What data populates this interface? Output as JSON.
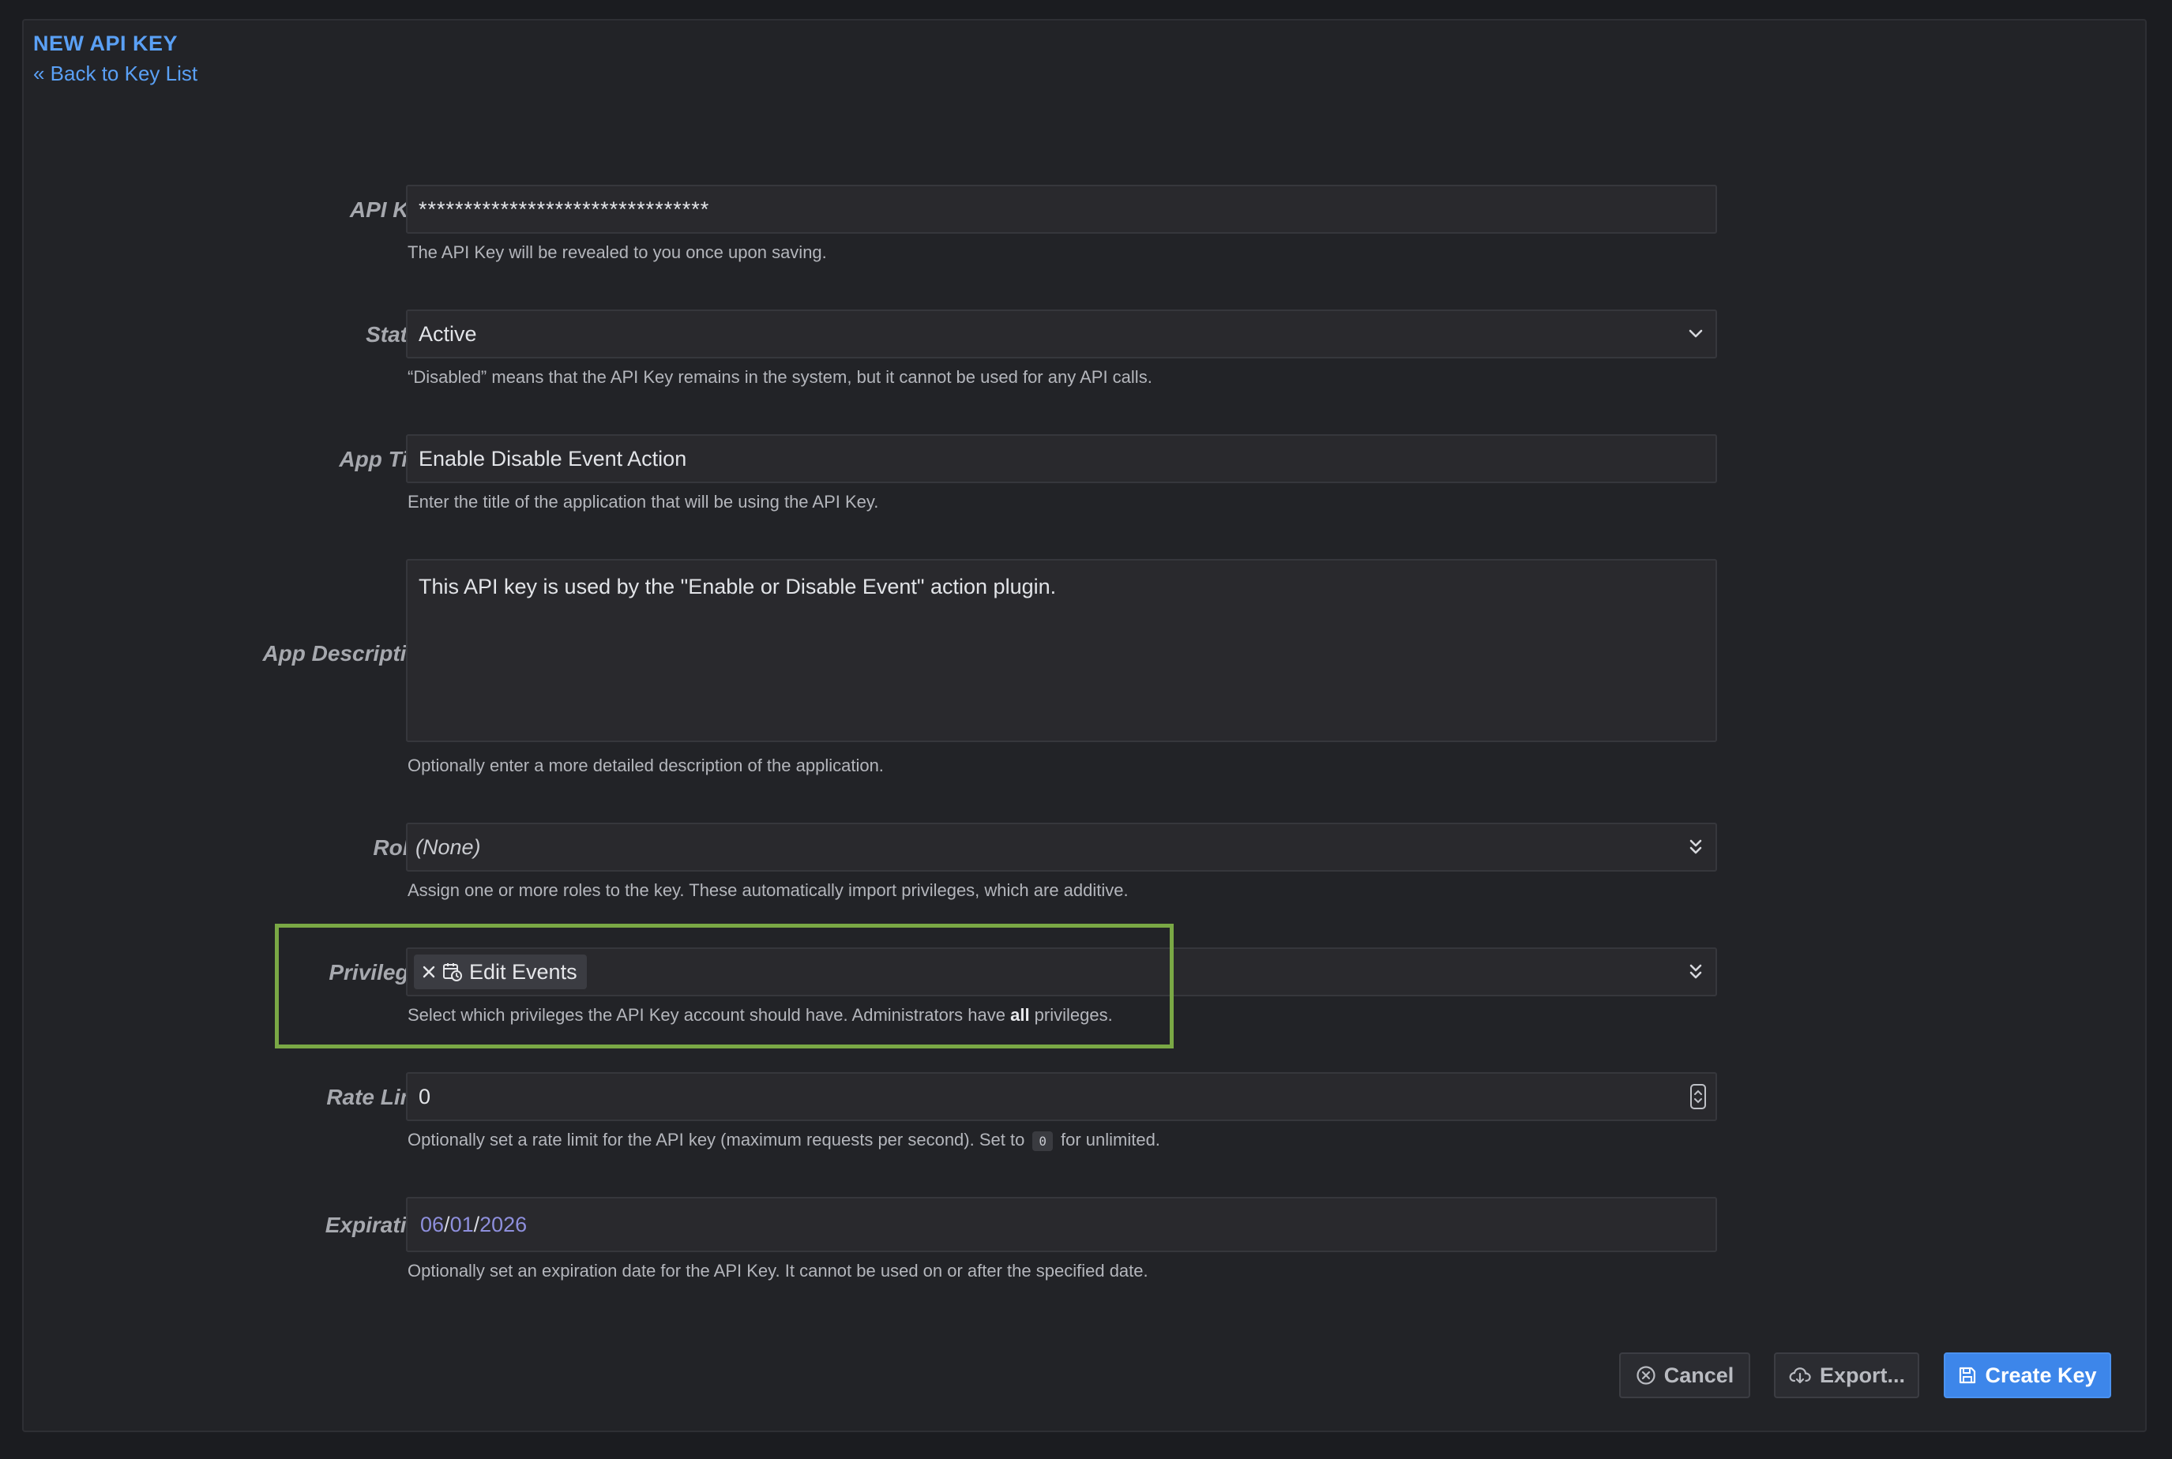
{
  "header": {
    "title": "NEW API KEY",
    "back_link": "« Back to Key List"
  },
  "fields": {
    "api_key": {
      "label": "API Key:",
      "value": "********************************",
      "caption": "The API Key will be revealed to you once upon saving."
    },
    "status": {
      "label": "Status:",
      "value": "Active",
      "caption": "“Disabled” means that the API Key remains in the system, but it cannot be used for any API calls."
    },
    "app_title": {
      "label": "App Title:",
      "value": "Enable Disable Event Action",
      "caption": "Enter the title of the application that will be using the API Key."
    },
    "app_description": {
      "label": "App Description:",
      "value": "This API key is used by the \"Enable or Disable Event\" action plugin.",
      "caption": "Optionally enter a more detailed description of the application."
    },
    "roles": {
      "label": "Roles:",
      "value": "(None)",
      "caption": "Assign one or more roles to the key. These automatically import privileges, which are additive."
    },
    "privileges": {
      "label": "Privileges:",
      "chips": [
        "Edit Events"
      ],
      "caption_before": "Select which privileges the API Key account should have. Administrators have ",
      "caption_bold": "all",
      "caption_after": " privileges."
    },
    "rate_limit": {
      "label": "Rate Limit:",
      "value": "0",
      "caption_before": "Optionally set a rate limit for the API key (maximum requests per second). Set to",
      "caption_code": "0",
      "caption_after": "for unlimited."
    },
    "expiration": {
      "label": "Expiration:",
      "month": "06",
      "day": "01",
      "year": "2026",
      "separator": "/",
      "caption": "Optionally set an expiration date for the API Key. It cannot be used on or after the specified date."
    }
  },
  "buttons": {
    "cancel": "Cancel",
    "export": "Export...",
    "create": "Create Key"
  },
  "colors": {
    "accent": "#5aa0f5",
    "primary_button": "#3d86ea",
    "highlight": "#7aa845"
  },
  "icons": {
    "chip_remove": "close-icon",
    "chip_privilege": "calendar-clock-icon",
    "cancel": "circle-x-icon",
    "export": "cloud-download-icon",
    "create": "floppy-disk-icon",
    "select": "chevron-down-icon",
    "multiselect": "double-chevron-down-icon"
  }
}
